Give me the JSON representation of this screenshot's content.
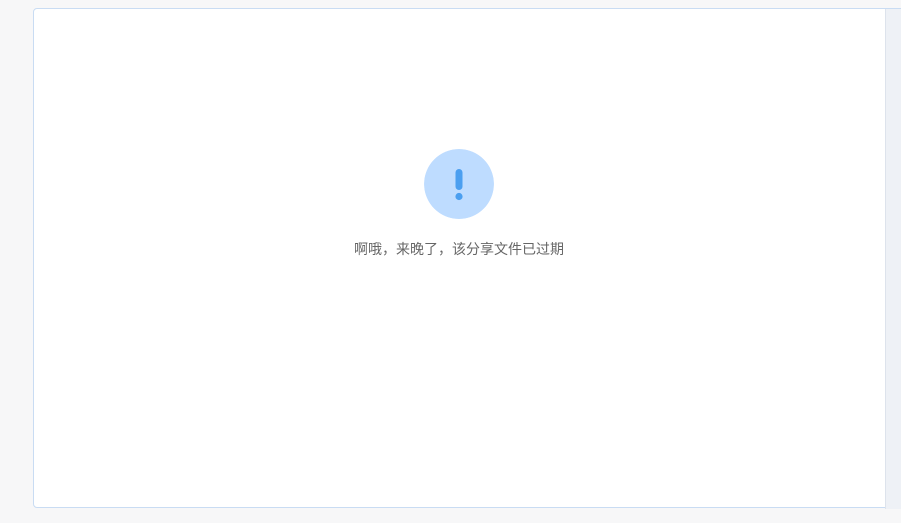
{
  "expired_notice": {
    "icon": "exclamation-circle-icon",
    "icon_bg_color": "#bedcff",
    "icon_fg_color": "#4b9ff0",
    "message": "啊哦，来晚了，该分享文件已过期"
  }
}
